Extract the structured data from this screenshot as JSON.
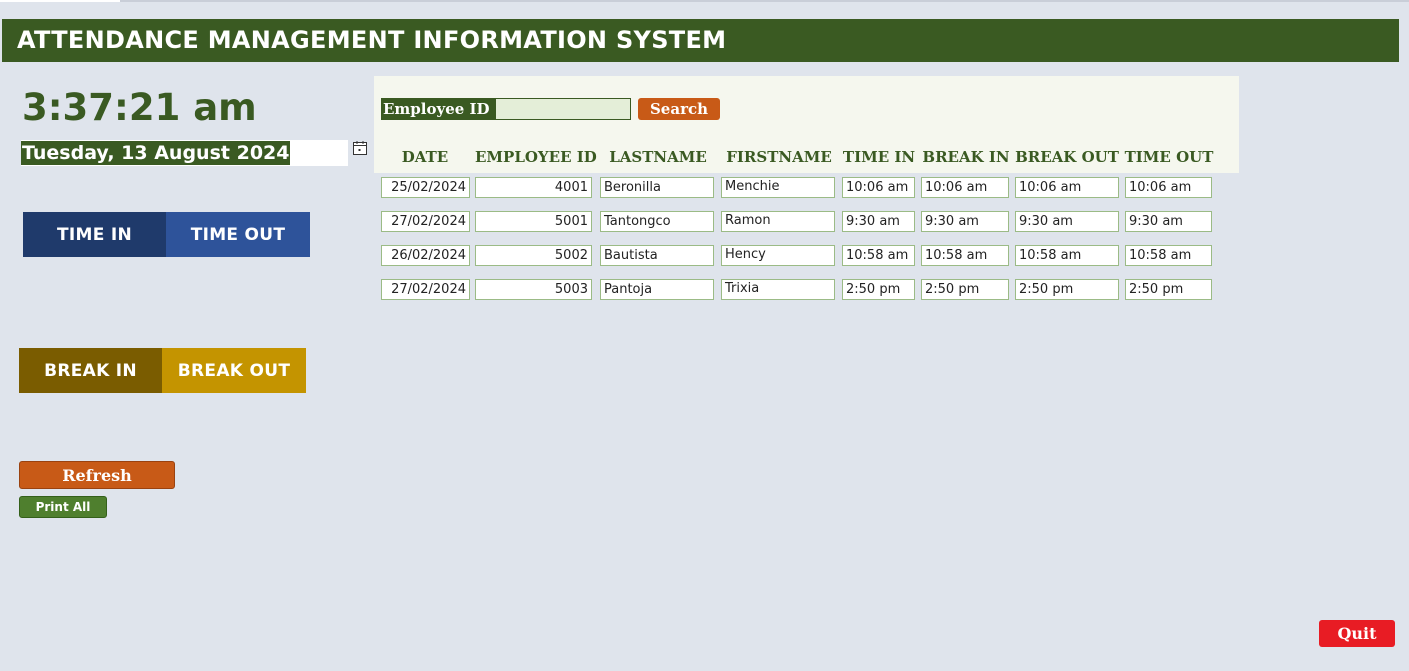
{
  "app": {
    "title": "ATTENDANCE MANAGEMENT INFORMATION SYSTEM"
  },
  "clock": {
    "time": "3:37:21 am",
    "date": "Tuesday, 13 August 2024"
  },
  "buttons": {
    "time_in": "TIME IN",
    "time_out": "TIME OUT",
    "break_in": "BREAK IN",
    "break_out": "BREAK OUT",
    "refresh": "Refresh",
    "print_all": "Print All",
    "quit": "Quit",
    "search": "Search"
  },
  "search": {
    "label": "Employee ID",
    "value": ""
  },
  "table": {
    "columns": [
      "DATE",
      "EMPLOYEE ID",
      "LASTNAME",
      "FIRSTNAME",
      "TIME IN",
      "BREAK IN",
      "BREAK OUT",
      "TIME OUT"
    ],
    "rows": [
      [
        "25/02/2024",
        "4001",
        "Beronilla",
        "Menchie",
        "10:06 am",
        "10:06 am",
        "10:06 am",
        "10:06 am"
      ],
      [
        "27/02/2024",
        "5001",
        "Tantongco",
        "Ramon",
        "9:30 am",
        "9:30 am",
        "9:30 am",
        "9:30 am"
      ],
      [
        "26/02/2024",
        "5002",
        "Bautista",
        "Hency",
        "10:58 am",
        "10:58 am",
        "10:58 am",
        "10:58 am"
      ],
      [
        "27/02/2024",
        "5003",
        "Pantoja",
        "Trixia",
        "2:50 pm",
        "2:50 pm",
        "2:50 pm",
        "2:50 pm"
      ]
    ]
  },
  "colors": {
    "primary_green": "#3a5a22",
    "time_in": "#1f3a6b",
    "time_out": "#2e539a",
    "break_in": "#7a5c00",
    "break_out": "#c49400",
    "accent_orange": "#c85a17",
    "quit_red": "#e81c24",
    "background": "#dfe4ec"
  },
  "icons": {
    "calendar": "calendar-icon"
  }
}
